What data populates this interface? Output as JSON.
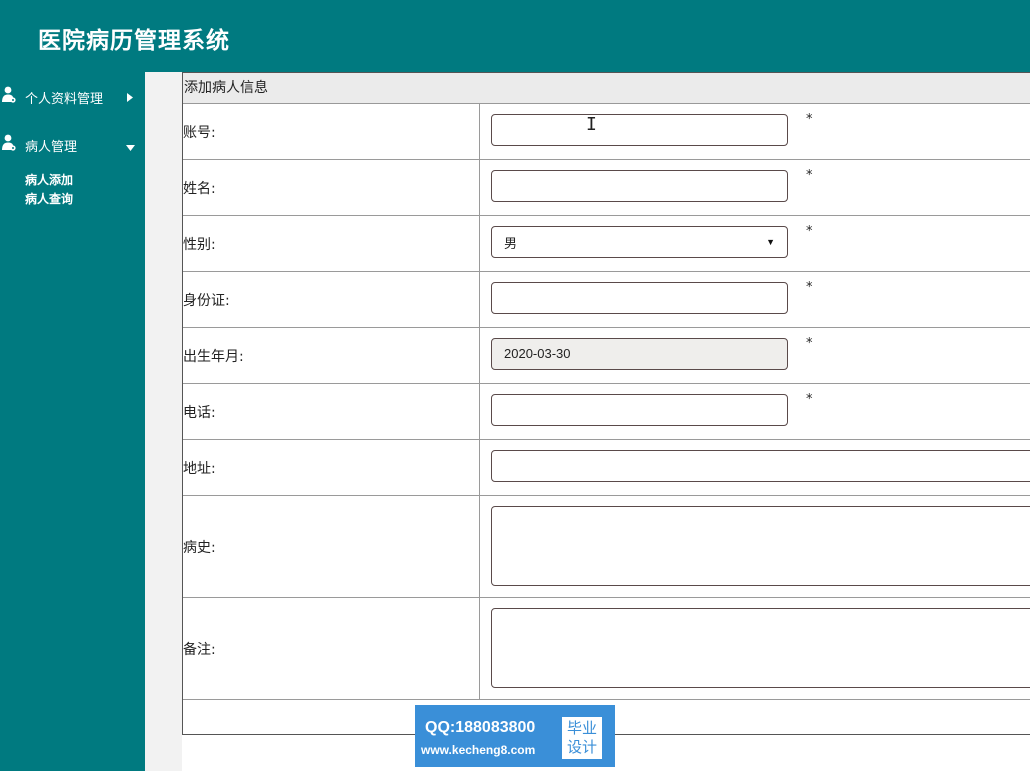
{
  "header": {
    "title": "医院病历管理系统"
  },
  "sidebar": {
    "menus": [
      {
        "label": "个人资料管理",
        "icon": "user-gear-icon",
        "caret": "▸"
      },
      {
        "label": "病人管理",
        "icon": "user-gear-icon",
        "caret": "▾"
      }
    ],
    "submenu": [
      "病人添加",
      "病人查询"
    ]
  },
  "form": {
    "heading": "添加病人信息",
    "fields": [
      {
        "label": "账号:",
        "value": "",
        "required": "*"
      },
      {
        "label": "姓名:",
        "value": "",
        "required": "*"
      },
      {
        "label": "性别:",
        "value": "男",
        "required": "*"
      },
      {
        "label": "身份证:",
        "value": "",
        "required": "*"
      },
      {
        "label": "出生年月:",
        "value": "2020-03-30",
        "required": "*"
      },
      {
        "label": "电话:",
        "value": "",
        "required": "*"
      },
      {
        "label": "地址:",
        "value": ""
      },
      {
        "label": "病史:",
        "value": ""
      },
      {
        "label": "备注:",
        "value": ""
      }
    ],
    "buttons": {
      "submit": "",
      "reset": ""
    }
  },
  "watermark": {
    "qq": "QQ:188083800",
    "url": "www.kecheng8.com",
    "badge_line1": "毕业",
    "badge_line2": "设计"
  },
  "colors": {
    "primary": "#007a80",
    "submit_button": "#e060b8",
    "reset_button": "#2bb3d8",
    "watermark_bg": "#3a8fd8"
  }
}
